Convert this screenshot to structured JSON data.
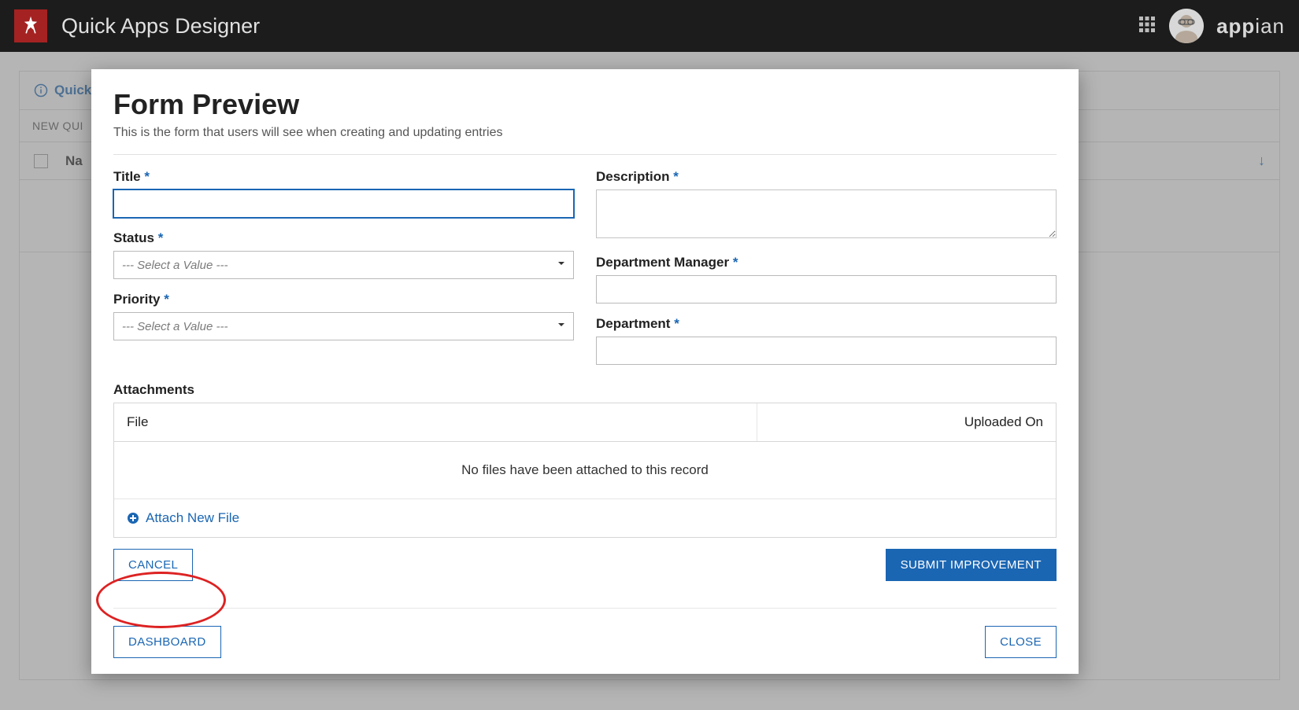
{
  "header": {
    "app_title": "Quick Apps Designer",
    "brand_main": "app",
    "brand_accent": "ian"
  },
  "workspace": {
    "header_label": "Quick",
    "tab_new": "NEW QUI",
    "col_name": "Na"
  },
  "modal": {
    "title": "Form Preview",
    "subtitle": "This is the form that users will see when creating and updating entries",
    "fields": {
      "title_label": "Title",
      "status_label": "Status",
      "priority_label": "Priority",
      "description_label": "Description",
      "dept_mgr_label": "Department Manager",
      "department_label": "Department",
      "select_placeholder": "--- Select a Value ---",
      "required_mark": "*"
    },
    "attachments": {
      "section": "Attachments",
      "col_file": "File",
      "col_uploaded": "Uploaded On",
      "empty": "No files have been attached to this record",
      "add_link": "Attach New File"
    },
    "buttons": {
      "cancel": "CANCEL",
      "submit": "SUBMIT IMPROVEMENT",
      "dashboard": "DASHBOARD",
      "close": "CLOSE"
    }
  }
}
